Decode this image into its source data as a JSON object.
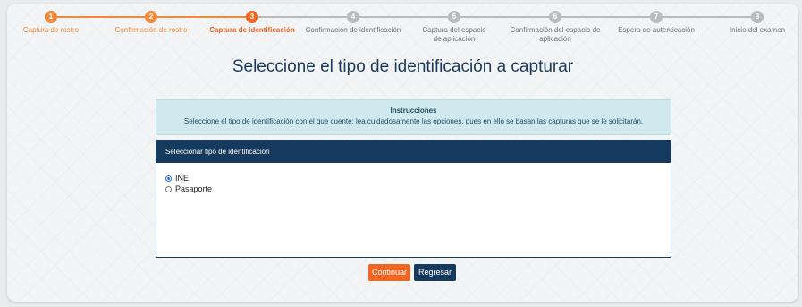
{
  "stepper": {
    "steps": [
      {
        "number": "1",
        "label": "Captura de rostro",
        "state": "done"
      },
      {
        "number": "2",
        "label": "Confirmación de rostro",
        "state": "done"
      },
      {
        "number": "3",
        "label": "Captura de identificación",
        "state": "active"
      },
      {
        "number": "4",
        "label": "Confirmación de identificación",
        "state": "todo"
      },
      {
        "number": "5",
        "label": "Captura del espacio de aplicación",
        "state": "todo"
      },
      {
        "number": "6",
        "label": "Confirmación del espacio de aplicación",
        "state": "todo"
      },
      {
        "number": "7",
        "label": "Espera de autenticación",
        "state": "todo"
      },
      {
        "number": "8",
        "label": "Inicio del examen",
        "state": "todo"
      }
    ],
    "colors": {
      "done": "#f08a3c",
      "active": "#f26522",
      "todo": "#b9bcbf"
    }
  },
  "page": {
    "title": "Seleccione el tipo de identificación a capturar"
  },
  "instructions": {
    "heading": "Instrucciones",
    "body": "Seleccione el tipo de identificación con el que cuente; lea cuidadosamente las opciones, pues en ello se basan las capturas que se le solicitarán."
  },
  "panel": {
    "header": "Seleccionar tipo de identificación",
    "options": [
      {
        "label": "INE",
        "selected": true
      },
      {
        "label": "Pasaporte",
        "selected": false
      }
    ]
  },
  "buttons": {
    "continue": "Continuar",
    "back": "Regresar"
  }
}
